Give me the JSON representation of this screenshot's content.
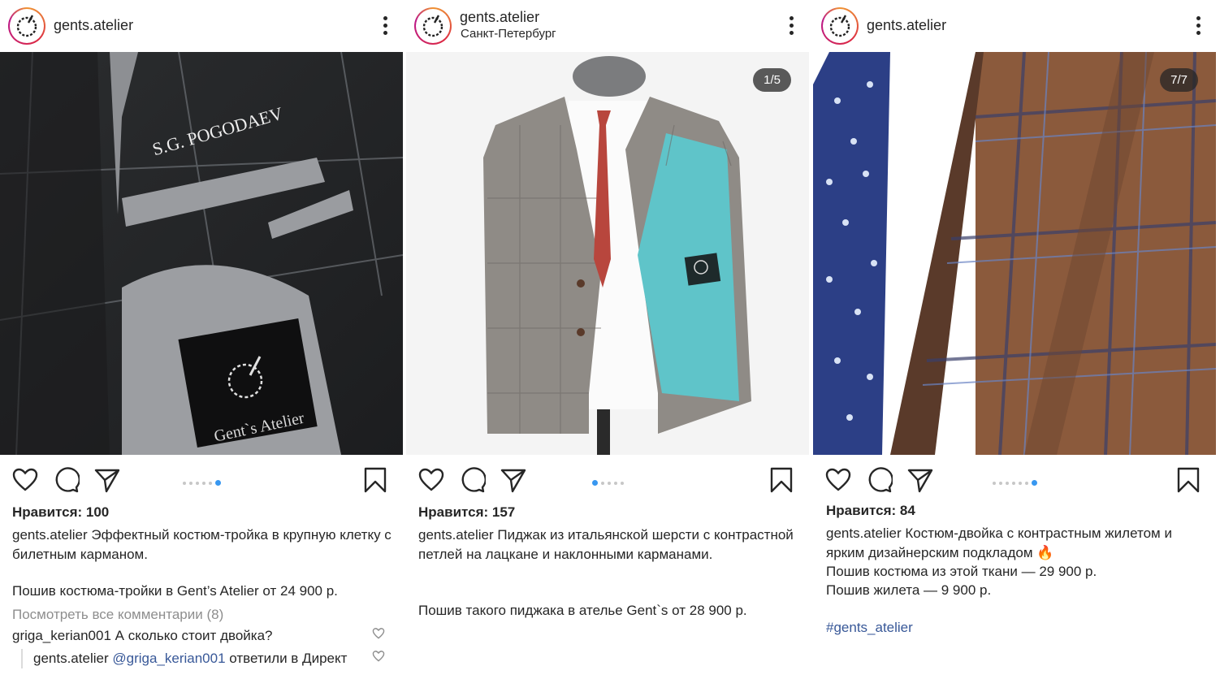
{
  "posts": [
    {
      "username": "gents.atelier",
      "location": "",
      "likes": "Нравится: 100",
      "caption": "Эффектный костюм-тройка в крупную клетку с билетным карманом.",
      "extra": "Пошив костюма-тройки в Gent’s Atelier от 24 900 р.",
      "view_comments": "Посмотреть все комментарии (8)",
      "comment1_user": "griga_kerian001",
      "comment1_text": "А сколько стоит двойка?",
      "reply_user": "gents.atelier",
      "reply_mention": "@griga_kerian001",
      "reply_text": "ответили в Директ",
      "photo_text_monogram": "S.G. POGODAEV",
      "photo_text_label": "Gent`s Atelier",
      "dots_active": 6
    },
    {
      "username": "gents.atelier",
      "location": "Санкт-Петербург",
      "likes": "Нравится: 157",
      "counter": "1/5",
      "caption": "Пиджак из итальянской шерсти с контрастной петлей на лацкане и наклонными карманами.",
      "extra": "Пошив такого пиджака в ателье Gent`s от 28 900 р.",
      "dots_active": 1
    },
    {
      "username": "gents.atelier",
      "location": "",
      "likes": "Нравится: 84",
      "counter": "7/7",
      "caption": "Костюм-двойка с контрастным жилетом и ярким дизайнерским подкладом 🔥",
      "line2": "Пошив костюма из этой ткани —  29 900 р.",
      "line3": "Пошив жилета — 9 900 р.",
      "hashtag": "#gents_atelier",
      "dots_active": 7
    }
  ],
  "colors": {
    "text": "#262626",
    "muted": "#8e8e8e",
    "link": "#385898",
    "dot_active": "#3897f0",
    "lining": "#5fc4c9"
  },
  "icons": [
    "heart-icon",
    "comment-icon",
    "share-icon",
    "bookmark-icon",
    "more-icon"
  ]
}
